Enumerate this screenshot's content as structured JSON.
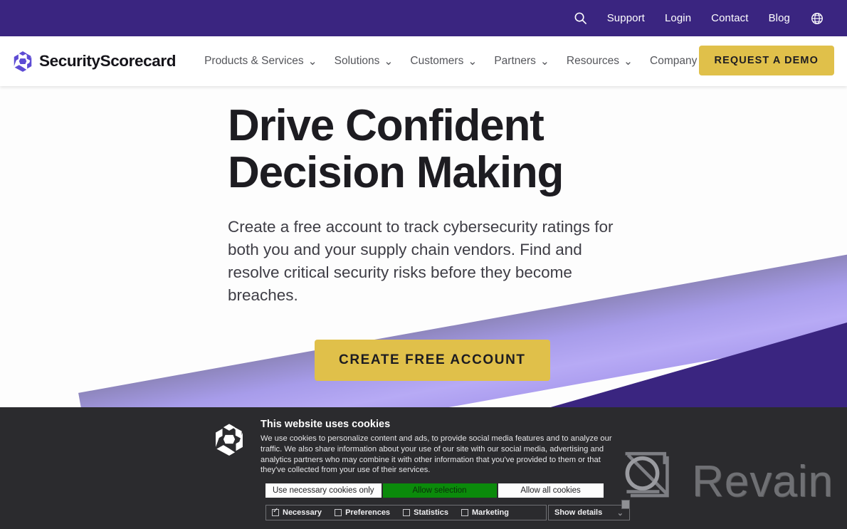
{
  "utilbar": {
    "search_icon": "search-icon",
    "globe_icon": "globe-icon",
    "links": [
      {
        "label": "Support"
      },
      {
        "label": "Login"
      },
      {
        "label": "Contact"
      },
      {
        "label": "Blog"
      }
    ]
  },
  "header": {
    "brand": {
      "name": "SecurityScorecard",
      "logo_icon": "securityscorecard-logo-icon"
    },
    "nav": [
      {
        "label": "Products & Services",
        "caret": "⌄"
      },
      {
        "label": "Solutions",
        "caret": "⌄"
      },
      {
        "label": "Customers",
        "caret": "⌄"
      },
      {
        "label": "Partners",
        "caret": "⌄"
      },
      {
        "label": "Resources",
        "caret": "⌄"
      },
      {
        "label": "Company",
        "caret": "⌄"
      }
    ],
    "demo_button": "REQUEST A DEMO"
  },
  "hero": {
    "title_line1": "Drive Confident",
    "title_line2": "Decision Making",
    "subtitle": "Create a free account to track cybersecurity ratings for both you and your supply chain vendors. Find and resolve critical security risks before they become breaches.",
    "cta_label": "CREATE FREE ACCOUNT"
  },
  "cookie_banner": {
    "logo_icon": "securityscorecard-logo-icon",
    "title": "This website uses cookies",
    "text": "We use cookies to personalize content and ads, to provide social media features and to analyze our traffic. We also share information about your use of our site with our social media, advertising and analytics partners who may combine it with other information that you've provided to them or that they've collected from your use of their services.",
    "buttons": [
      {
        "label": "Use necessary cookies only",
        "style": "white"
      },
      {
        "label": "Allow selection",
        "style": "green"
      },
      {
        "label": "Allow all cookies",
        "style": "white"
      }
    ],
    "options": [
      {
        "label": "Necessary",
        "checked": true
      },
      {
        "label": "Preferences",
        "checked": false
      },
      {
        "label": "Statistics",
        "checked": false
      },
      {
        "label": "Marketing",
        "checked": false
      }
    ],
    "details_label": "Show details",
    "details_caret": "⌄"
  },
  "watermark": {
    "text": "Revain",
    "logo_icon": "revain-logo-icon"
  },
  "colors": {
    "brand_purple": "#3a2580",
    "accent_gold": "#e0c04a",
    "band_purple": "#b7aaf5",
    "cookie_bg": "#2b2b2e",
    "allow_selection_green": "#0b8a0b"
  }
}
